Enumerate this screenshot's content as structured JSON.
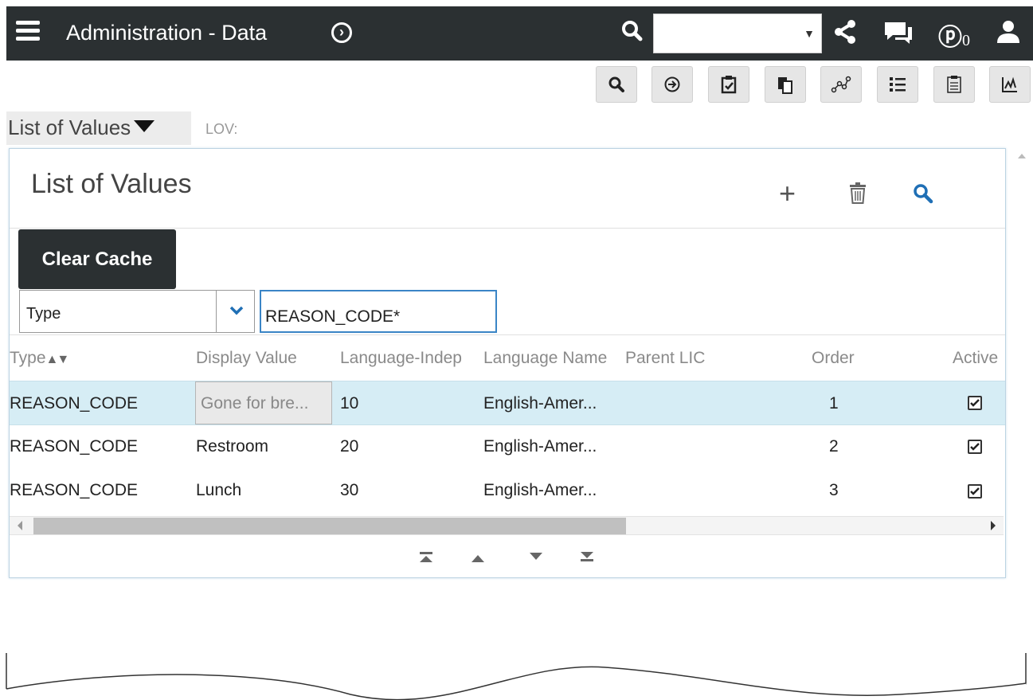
{
  "app": {
    "title": "Administration - Data"
  },
  "header": {
    "notification_count": "0"
  },
  "breadcrumb": {
    "view": "List of Values",
    "sub_label": "LOV:"
  },
  "applet": {
    "title": "List of Values",
    "clear_cache_label": "Clear Cache",
    "query_field": "Type",
    "query_value": "REASON_CODE*"
  },
  "table": {
    "headers": [
      "Type",
      "Display Value",
      "Language-Indep",
      "Language Name",
      "Parent LIC",
      "Order",
      "Active"
    ],
    "rows": [
      {
        "type": "REASON_CODE",
        "display_value": "Gone for bre...",
        "lic": "10",
        "language": "English-Amer...",
        "parent_lic": "",
        "order": "1",
        "active": true
      },
      {
        "type": "REASON_CODE",
        "display_value": "Restroom",
        "lic": "20",
        "language": "English-Amer...",
        "parent_lic": "",
        "order": "2",
        "active": true
      },
      {
        "type": "REASON_CODE",
        "display_value": "Lunch",
        "lic": "30",
        "language": "English-Amer...",
        "parent_lic": "",
        "order": "3",
        "active": true
      }
    ]
  },
  "colors": {
    "topbar": "#2b3032",
    "selected_row": "#d6edf5",
    "accent_blue": "#1f6fb5",
    "query_border": "#3a85c6"
  },
  "icons": {
    "toolbar": [
      "search-icon",
      "go-arrow-icon",
      "clipboard-check-icon",
      "copy-icon",
      "network-icon",
      "list-icon",
      "notes-icon",
      "chart-icon"
    ],
    "header": [
      "menu-icon",
      "navigate-icon",
      "search-icon",
      "share-icon",
      "chat-icon",
      "notifications-icon",
      "user-icon"
    ]
  }
}
